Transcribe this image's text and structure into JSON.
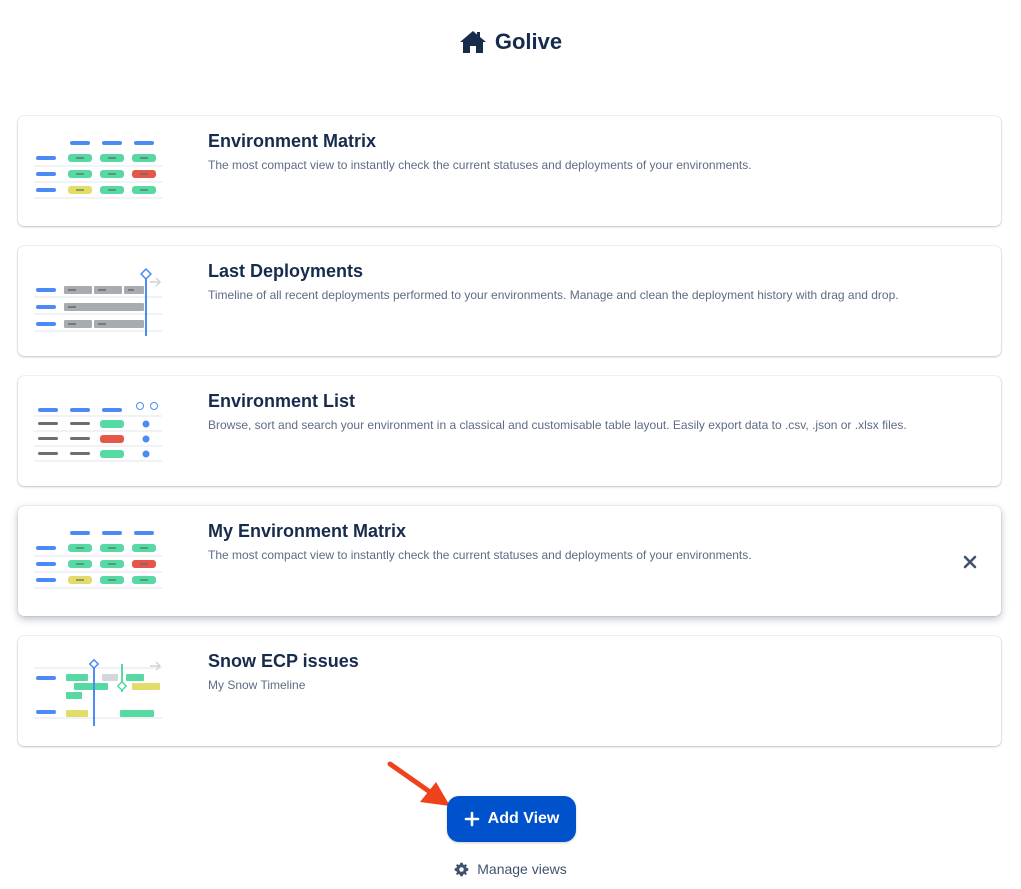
{
  "header": {
    "title": "Golive",
    "icon": "home-icon"
  },
  "views": [
    {
      "title": "Environment Matrix",
      "description": "The most compact view to instantly check the current statuses and deployments of your environments.",
      "thumbnail": "matrix"
    },
    {
      "title": "Last Deployments",
      "description": "Timeline of all recent deployments performed to your environments. Manage and clean the deployment history with drag and drop.",
      "thumbnail": "timeline"
    },
    {
      "title": "Environment List",
      "description": "Browse, sort and search your environment in a classical and customisable table layout. Easily export data to .csv, .json or .xlsx files.",
      "thumbnail": "list"
    },
    {
      "title": "My Environment Matrix",
      "description": "The most compact view to instantly check the current statuses and deployments of your environments.",
      "thumbnail": "matrix",
      "removable": true
    },
    {
      "title": "Snow ECP issues",
      "description": "My Snow Timeline",
      "thumbnail": "snow-timeline"
    }
  ],
  "actions": {
    "add_view_label": "Add View",
    "manage_views_label": "Manage views"
  },
  "colors": {
    "primary": "#0052cc",
    "title": "#172b4d",
    "subtle": "#5e6c84",
    "arrow": "#f0421a",
    "status_green": "#57d9a3",
    "status_red": "#e5574a",
    "status_yellow": "#e2dc6a",
    "thumb_blue": "#4c8bf5"
  }
}
